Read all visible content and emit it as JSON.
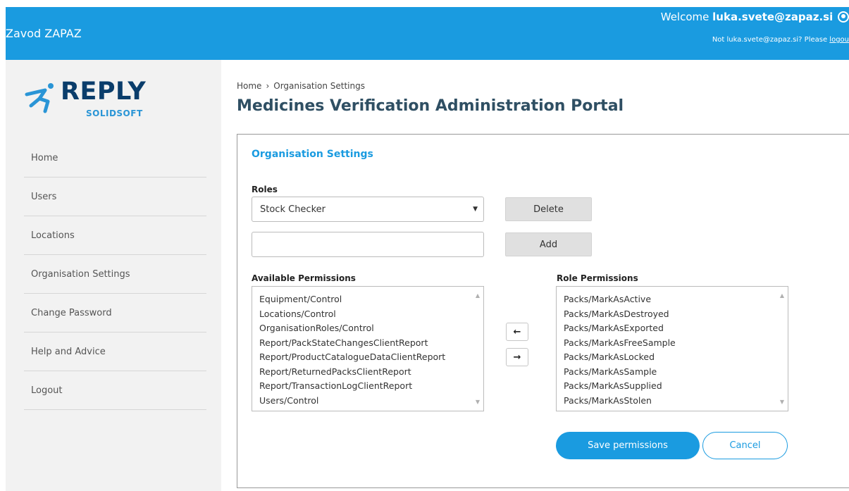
{
  "header": {
    "org_name": "Zavod ZAPAZ",
    "welcome_prefix": "Welcome",
    "username": "luka.svete@zapaz.si",
    "not_user_text": "Not luka.svete@zapaz.si? Please",
    "logout_link": "logou"
  },
  "logo": {
    "word": "REPLY",
    "sub": "SOLIDSOFT"
  },
  "sidebar": {
    "items": [
      {
        "label": "Home"
      },
      {
        "label": "Users"
      },
      {
        "label": "Locations"
      },
      {
        "label": "Organisation Settings"
      },
      {
        "label": "Change Password"
      },
      {
        "label": "Help and Advice"
      },
      {
        "label": "Logout"
      }
    ]
  },
  "breadcrumb": {
    "home": "Home",
    "separator": "›",
    "current": "Organisation Settings"
  },
  "page_title": "Medicines Verification Administration Portal",
  "panel": {
    "heading": "Organisation Settings",
    "roles_label": "Roles",
    "role_selected": "Stock Checker",
    "new_role_value": "",
    "delete_label": "Delete",
    "add_label": "Add",
    "available_label": "Available Permissions",
    "role_perm_label": "Role Permissions",
    "available_permissions": [
      "Equipment/Control",
      "Locations/Control",
      "OrganisationRoles/Control",
      "Report/PackStateChangesClientReport",
      "Report/ProductCatalogueDataClientReport",
      "Report/ReturnedPacksClientReport",
      "Report/TransactionLogClientReport",
      "Users/Control"
    ],
    "role_permissions": [
      "Packs/MarkAsActive",
      "Packs/MarkAsDestroyed",
      "Packs/MarkAsExported",
      "Packs/MarkAsFreeSample",
      "Packs/MarkAsLocked",
      "Packs/MarkAsSample",
      "Packs/MarkAsSupplied",
      "Packs/MarkAsStolen"
    ],
    "move_left": "←",
    "move_right": "→",
    "save_label": "Save permissions",
    "cancel_label": "Cancel"
  },
  "colors": {
    "accent": "#1a9be0",
    "title": "#2f4f63",
    "sidebar_bg": "#f2f2f2",
    "logo_dark": "#0a3d6b"
  }
}
